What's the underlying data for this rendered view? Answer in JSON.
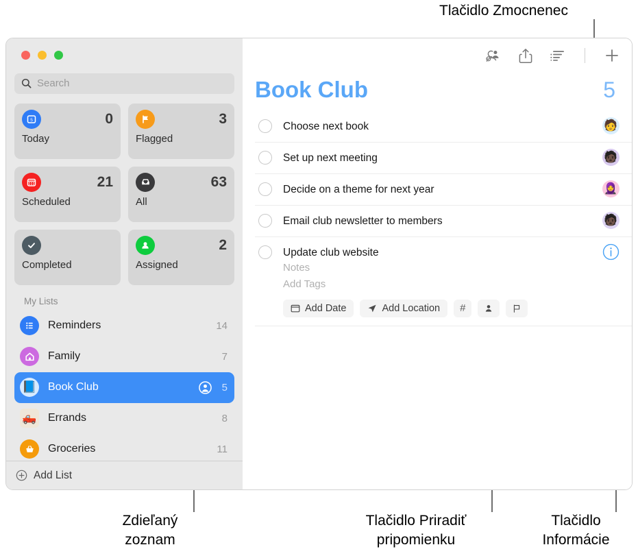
{
  "annotations": [
    {
      "id": "delegate",
      "text": "Tlačidlo Zmocnenec"
    },
    {
      "id": "shared-list",
      "text": "Zdieľaný\nzoznam"
    },
    {
      "id": "assign",
      "text": "Tlačidlo Priradiť\npripomienku"
    },
    {
      "id": "info",
      "text": "Tlačidlo\nInformácie"
    }
  ],
  "window": {
    "traffic_lights": [
      "close",
      "minimize",
      "zoom"
    ]
  },
  "sidebar": {
    "search": {
      "placeholder": "Search",
      "value": "",
      "icon": "search-icon"
    },
    "smart_lists": [
      {
        "label": "Today",
        "count": "0",
        "icon": "today-icon",
        "color": "#2f7cf6"
      },
      {
        "label": "Flagged",
        "count": "3",
        "icon": "flag-icon",
        "color": "#f79b1a"
      },
      {
        "label": "Scheduled",
        "count": "21",
        "icon": "calendar-icon",
        "color": "#f52222"
      },
      {
        "label": "All",
        "count": "63",
        "icon": "inbox-icon",
        "color": "#3a3a3c"
      },
      {
        "label": "Completed",
        "count": "",
        "icon": "checkmark-icon",
        "color": "#4d5b63"
      },
      {
        "label": "Assigned",
        "count": "2",
        "icon": "person-icon",
        "color": "#0ecc3e"
      }
    ],
    "my_lists_header": "My Lists",
    "lists": [
      {
        "label": "Reminders",
        "count": "14",
        "icon": "bullet-list-icon",
        "color": "#2f7cf6",
        "glyph": "",
        "selected": false,
        "shared": false
      },
      {
        "label": "Family",
        "count": "7",
        "icon": "house-icon",
        "color": "#cc6ae0",
        "glyph": "",
        "selected": false,
        "shared": false
      },
      {
        "label": "Book Club",
        "count": "5",
        "icon": "book-icon",
        "color": "#d6eaff",
        "glyph": "📘",
        "selected": true,
        "shared": true
      },
      {
        "label": "Errands",
        "count": "8",
        "icon": "truck-icon",
        "color": "#efe6d8",
        "glyph": "🛻",
        "selected": false,
        "shared": false
      },
      {
        "label": "Groceries",
        "count": "11",
        "icon": "basket-icon",
        "color": "#f59b0b",
        "glyph": "",
        "selected": false,
        "shared": false
      }
    ],
    "add_list_label": "Add List",
    "add_list_icon": "plus-circle-icon"
  },
  "main": {
    "toolbar": [
      {
        "name": "delegate-button",
        "icon": "person-badge-check-icon"
      },
      {
        "name": "share-button",
        "icon": "share-icon"
      },
      {
        "name": "sort-button",
        "icon": "list-sort-icon"
      },
      {
        "name": "add-reminder-button",
        "icon": "plus-icon"
      }
    ],
    "title": "Book Club",
    "count": "5",
    "accent_color": "#5aa7f7",
    "tasks": [
      {
        "title": "Choose next book",
        "avatar": "🧑",
        "avatar_bg": "#d9eefc",
        "kind": "avatar"
      },
      {
        "title": "Set up next meeting",
        "avatar": "🧑🏿",
        "avatar_bg": "#d8c9ee",
        "kind": "avatar"
      },
      {
        "title": "Decide on a theme for next year",
        "avatar": "🧕",
        "avatar_bg": "#fbc6dd",
        "kind": "avatar"
      },
      {
        "title": "Email club newsletter to members",
        "avatar": "🧑🏿",
        "avatar_bg": "#ddd3f2",
        "kind": "avatar"
      },
      {
        "title": "Update club website",
        "notes_placeholder": "Notes",
        "tags_placeholder": "Add Tags",
        "kind": "editing",
        "info_icon": "info-circle-icon",
        "chips": [
          {
            "label": "Add Date",
            "icon": "calendar-chip-icon",
            "name": "add-date-chip"
          },
          {
            "label": "Add Location",
            "icon": "location-chip-icon",
            "name": "add-location-chip"
          },
          {
            "label": "#",
            "icon": "hash-chip-icon",
            "name": "add-tag-chip"
          },
          {
            "label": "",
            "icon": "person-chip-icon",
            "name": "assign-reminder-chip"
          },
          {
            "label": "",
            "icon": "flag-chip-icon",
            "name": "flag-chip"
          }
        ]
      }
    ]
  }
}
